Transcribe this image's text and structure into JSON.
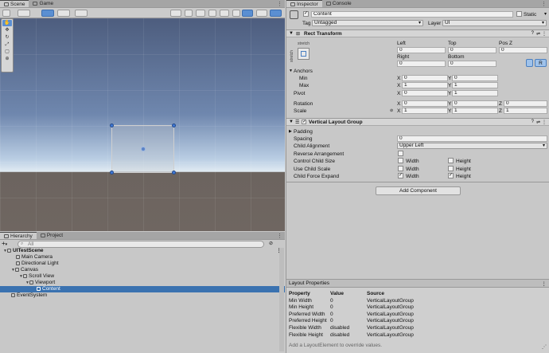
{
  "scene_tabs": [
    {
      "label": "Scene"
    },
    {
      "label": "Game"
    }
  ],
  "scene_toolbar": {
    "left_icon": "hand-icon",
    "is_2d": "2D",
    "gizmo_icon": "gizmos-icon"
  },
  "hierarchy": {
    "tabs": [
      {
        "label": "Hierarchy"
      },
      {
        "label": "Project"
      }
    ],
    "add_label": "+",
    "search_placeholder": "All",
    "rows": [
      {
        "label": "UITestScene"
      },
      {
        "label": "Main Camera"
      },
      {
        "label": "Directional Light"
      },
      {
        "label": "Canvas"
      },
      {
        "label": "Scroll View"
      },
      {
        "label": "Viewport"
      },
      {
        "label": "Content"
      },
      {
        "label": "EventSystem"
      }
    ]
  },
  "inspector": {
    "tabs": [
      {
        "label": "Inspector"
      },
      {
        "label": "Console"
      }
    ],
    "object_name": "Content",
    "static_label": "Static",
    "tag_label": "Tag",
    "tag_value": "Untagged",
    "layer_label": "Layer",
    "layer_value": "UI",
    "rect_transform": {
      "title": "Rect Transform",
      "anchor_preset_top": "stretch",
      "anchor_preset_side": "stretch",
      "col_left": "Left",
      "col_top": "Top",
      "col_posz": "Pos Z",
      "left": "0",
      "top": "0",
      "posz": "0",
      "col_right": "Right",
      "col_bottom": "Bottom",
      "right": "0",
      "bottom": "0",
      "r_button": "R",
      "anchors": "Anchors",
      "min": "Min",
      "max": "Max",
      "min_x": "0",
      "min_y": "0",
      "max_x": "1",
      "max_y": "1",
      "pivot": "Pivot",
      "pivot_x": "0",
      "pivot_y": "1",
      "rotation": "Rotation",
      "rot_x": "0",
      "rot_y": "0",
      "rot_z": "0",
      "scale": "Scale",
      "scale_x": "1",
      "scale_y": "1",
      "scale_z": "1",
      "x": "X",
      "y": "Y",
      "z": "Z"
    },
    "vlg": {
      "title": "Vertical Layout Group",
      "padding": "Padding",
      "spacing_label": "Spacing",
      "spacing": "0",
      "child_alignment_label": "Child Alignment",
      "child_alignment": "Upper Left",
      "reverse_label": "Reverse Arrangement",
      "control_size_label": "Control Child Size",
      "use_scale_label": "Use Child Scale",
      "force_expand_label": "Child Force Expand",
      "width": "Width",
      "height": "Height"
    },
    "add_component": "Add Component",
    "layout_properties": {
      "title": "Layout Properties",
      "headers": [
        "Property",
        "Value",
        "Source"
      ],
      "rows": [
        [
          "Min Width",
          "0",
          "VerticalLayoutGroup"
        ],
        [
          "Min Height",
          "0",
          "VerticalLayoutGroup"
        ],
        [
          "Preferred Width",
          "0",
          "VerticalLayoutGroup"
        ],
        [
          "Preferred Height",
          "0",
          "VerticalLayoutGroup"
        ],
        [
          "Flexible Width",
          "disabled",
          "VerticalLayoutGroup"
        ],
        [
          "Flexible Height",
          "disabled",
          "VerticalLayoutGroup"
        ]
      ],
      "footer_note": "Add a LayoutElement to override values."
    }
  },
  "colors": {
    "selection": "#3a72b0",
    "accent": "#5b8fd2",
    "panel": "#c8c8c8"
  }
}
